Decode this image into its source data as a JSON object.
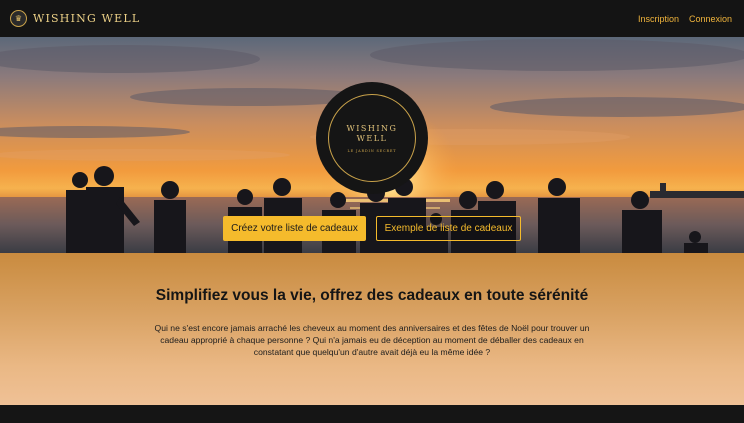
{
  "nav": {
    "brand": "WISHING WELL",
    "links": [
      "Inscription",
      "Connexion"
    ]
  },
  "hero": {
    "logo_line1": "WISHING",
    "logo_line2": "WELL",
    "logo_tagline": "LE JARDIN SECRET",
    "primary_cta": "Créez votre liste de cadeaux",
    "secondary_cta": "Exemple de liste de cadeaux"
  },
  "intro": {
    "title": "Simplifiez vous la vie, offrez des cadeaux en toute sérénité",
    "body": "Qui ne s'est encore jamais arraché les cheveux au moment des anniversaires et des fêtes de Noël pour trouver un cadeau approprié à chaque personne ? Qui n'a jamais eu de déception au moment de déballer des cadeaux en constatant que quelqu'un d'autre avait déjà eu la même idée ?"
  },
  "colors": {
    "accent": "#f5bb2c",
    "dark": "#141414",
    "gold": "#c9a24a"
  }
}
